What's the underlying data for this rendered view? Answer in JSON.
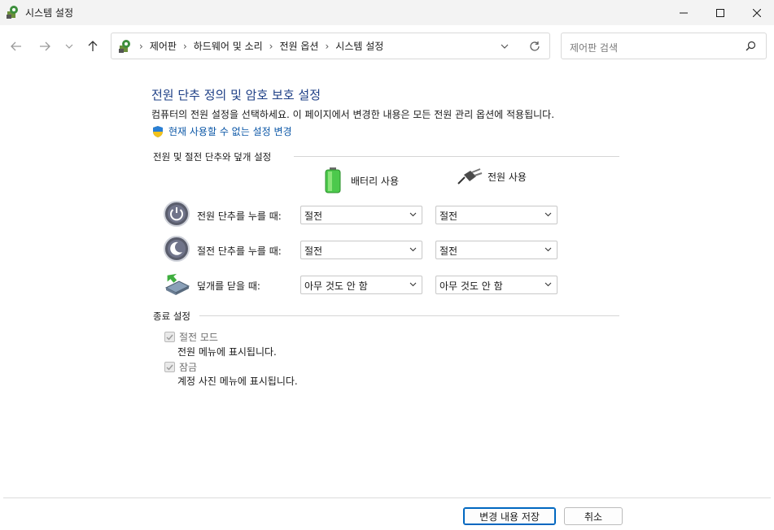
{
  "window": {
    "title": "시스템 설정"
  },
  "address": {
    "crumbs": [
      "제어판",
      "하드웨어 및 소리",
      "전원 옵션",
      "시스템 설정"
    ]
  },
  "search": {
    "placeholder": "제어판 검색"
  },
  "main": {
    "title": "전원 단추 정의 및 암호 보호 설정",
    "description": "컴퓨터의 전원 설정을 선택하세요. 이 페이지에서 변경한 내용은 모든 전원 관리 옵션에 적용됩니다.",
    "change_link": "현재 사용할 수 없는 설정 변경"
  },
  "buttons_section": {
    "heading": "전원 및 절전 단추와 덮개 설정",
    "battery_label": "배터리 사용",
    "plugged_label": "전원 사용",
    "rows": [
      {
        "label": "전원 단추를 누를 때:",
        "battery": "절전",
        "plugged": "절전"
      },
      {
        "label": "절전 단추를 누를 때:",
        "battery": "절전",
        "plugged": "절전"
      },
      {
        "label": "덮개를 닫을 때:",
        "battery": "아무 것도 안 함",
        "plugged": "아무 것도 안 함"
      }
    ]
  },
  "shutdown_section": {
    "heading": "종료 설정",
    "items": [
      {
        "label": "절전 모드",
        "desc": "전원 메뉴에 표시됩니다.",
        "checked": true
      },
      {
        "label": "잠금",
        "desc": "계정 사진 메뉴에 표시됩니다.",
        "checked": true
      }
    ]
  },
  "footer": {
    "save_label": "변경 내용 저장",
    "cancel_label": "취소"
  },
  "colors": {
    "title_blue": "#1e3f86",
    "link_blue": "#0a56a6",
    "accent": "#0067c0"
  },
  "icons": [
    "control-panel-icon",
    "minimize-icon",
    "maximize-icon",
    "close-icon",
    "back-arrow-icon",
    "forward-arrow-icon",
    "recent-dropdown-icon",
    "up-arrow-icon",
    "chevron-right-icon",
    "chevron-down-icon",
    "refresh-icon",
    "search-icon",
    "shield-icon",
    "battery-icon",
    "power-plug-icon",
    "power-button-icon",
    "sleep-button-icon",
    "laptop-lid-icon",
    "checkmark-icon"
  ]
}
